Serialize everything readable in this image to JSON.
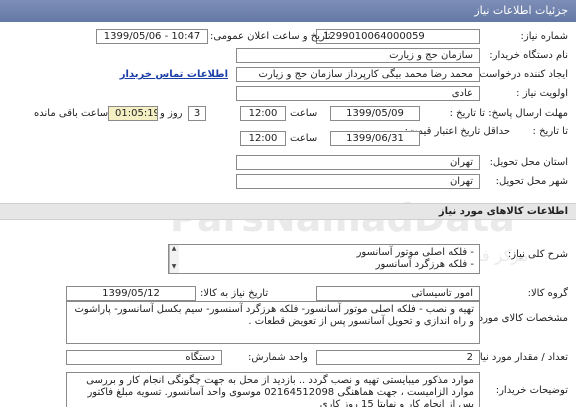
{
  "header": {
    "title": "جزئیات اطلاعات نیاز"
  },
  "labels": {
    "need_number": "شماره نیاز:",
    "announce_datetime": "تاریخ و ساعت اعلان عمومی:",
    "buyer_org": "نام دستگاه خریدار:",
    "creator": "ایجاد کننده درخواست:",
    "priority": "اولویت نیاز :",
    "reply_deadline": "مهلت ارسال پاسخ: تا تاریخ :",
    "price_validity": "حداقل تاریخ اعتبار قیمت:",
    "to_date": "تا تاریخ :",
    "time": "ساعت",
    "day_and": "روز و",
    "remaining": "ساعت باقی مانده",
    "delivery_province": "استان محل تحویل:",
    "delivery_city": "شهر محل تحویل:",
    "goods_name": "شرح کلی نیاز:",
    "goods_group": "گروه کالا:",
    "need_date": "تاریخ نیاز به کالا:",
    "goods_specs": "مشخصات کالای مورد نیاز:",
    "quantity": "تعداد / مقدار مورد نیاز:",
    "unit": "واحد شمارش:",
    "buyer_desc": "توضیحات خریدار:"
  },
  "values": {
    "need_number": "1299010064000059",
    "announce_datetime": "1399/05/06 - 10:47",
    "buyer_org": "سازمان حج و زیارت",
    "creator": "محمد رضا محمد بیگی کارپرداز سازمان حج و زیارت",
    "contact_link": "اطلاعات تماس خریدار",
    "priority": "عادی",
    "reply_date": "1399/05/09",
    "reply_time": "12:00",
    "remaining_days": "3",
    "remaining_time": "01:05:19",
    "validity_date": "1399/06/31",
    "validity_time": "12:00",
    "province": "تهران",
    "city": "تهران",
    "goods_lines": [
      "- فلکه اصلی موتور آسانسور",
      "- فلکه هرزگرد آسانسور"
    ],
    "goods_group": "امور تاسیساتی",
    "need_date": "1399/05/12",
    "specs": "تهیه و نصب - فلکه اصلی موتور آسانسور- فلکه هرزگرد آسنسور- سیم بکسل آسانسور- پاراشوت و راه اندازی و تحویل آسانسور پس از تعویض قطعات .",
    "quantity": "2",
    "unit": "دستگاه",
    "buyer_desc": "موارد مذکور میبایستی تهیه و نصب گردد .. بازدید از محل به جهت چگونگی انجام کار و بررسی موارد الزامیست ، جهت هماهنگی 02164512098 موسوی واحد آسانسور. تسویه مبلغ فاکتور پس از انجام کار و نهایتا 15 روز کاری"
  },
  "sections": {
    "goods_info": "اطلاعات کالاهای مورد نیاز"
  },
  "watermark": {
    "main": "ParsNamadData",
    "sub": "مرکز فناوری اطلاعات پارس نماد داده ها"
  }
}
